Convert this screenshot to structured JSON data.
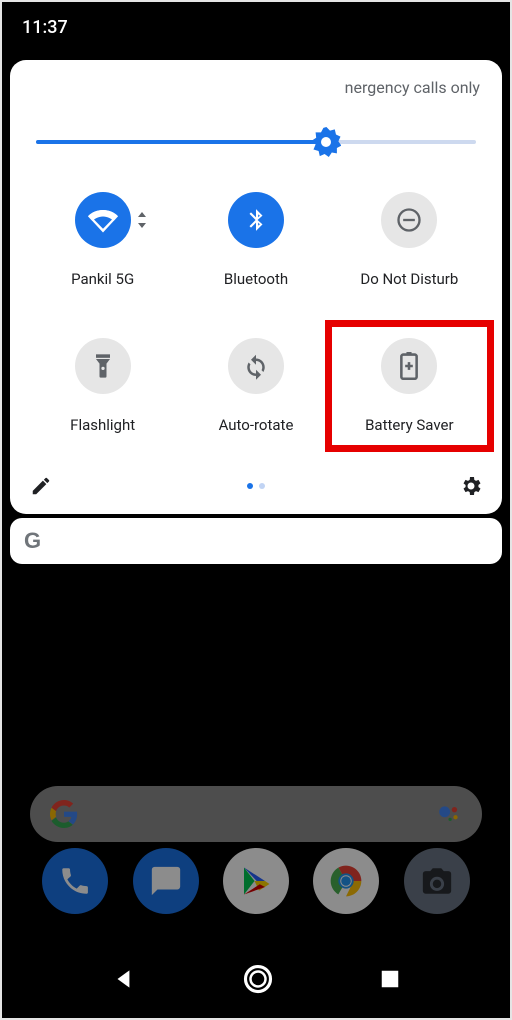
{
  "status_bar": {
    "time": "11:37"
  },
  "qs": {
    "network_status": "nergency calls only",
    "brightness_pct": 66,
    "tiles": [
      {
        "id": "wifi",
        "label": "Pankil 5G",
        "active": true,
        "icon": "wifi-icon",
        "expandable": true
      },
      {
        "id": "bluetooth",
        "label": "Bluetooth",
        "active": true,
        "icon": "bluetooth-icon",
        "expandable": false
      },
      {
        "id": "dnd",
        "label": "Do Not Disturb",
        "active": false,
        "icon": "dnd-icon",
        "expandable": false
      },
      {
        "id": "flashlight",
        "label": "Flashlight",
        "active": false,
        "icon": "flashlight-icon",
        "expandable": false
      },
      {
        "id": "autorotate",
        "label": "Auto-rotate",
        "active": false,
        "icon": "autorotate-icon",
        "expandable": false
      },
      {
        "id": "battery",
        "label": "Battery Saver",
        "active": false,
        "icon": "battery-icon",
        "expandable": false,
        "highlighted": true
      }
    ],
    "page_count": 2,
    "page_active": 0
  },
  "google_bar": {
    "letter": "G"
  },
  "dock": {
    "apps": [
      {
        "id": "phone",
        "icon": "phone-icon"
      },
      {
        "id": "messages",
        "icon": "messages-icon"
      },
      {
        "id": "play",
        "icon": "play-icon"
      },
      {
        "id": "chrome",
        "icon": "chrome-icon"
      },
      {
        "id": "camera",
        "icon": "camera-icon"
      }
    ]
  },
  "navbar": {
    "back": "back-icon",
    "home": "home-icon",
    "recent": "recent-icon"
  },
  "colors": {
    "accent": "#1a73e8",
    "inactive": "#e6e6e6",
    "highlight": "#e60000"
  }
}
